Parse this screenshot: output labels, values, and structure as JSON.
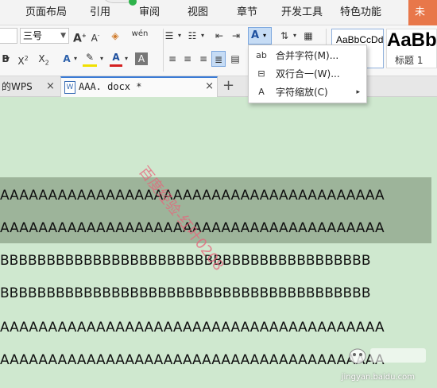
{
  "menu": {
    "items": [
      "页面布局",
      "引用",
      "审阅",
      "视图",
      "章节",
      "开发工具",
      "特色功能"
    ],
    "right_tab": "未"
  },
  "ribbon": {
    "font_size": "三号",
    "font_size_value": "三号",
    "styles": [
      {
        "preview": "AaBbCcDd",
        "name": ""
      },
      {
        "preview": "AaBb",
        "name": "标题 1"
      }
    ],
    "accent_color": "#3a7bd5",
    "font_color_underline": "#d42020",
    "highlight_underline": "#f0e000"
  },
  "tabs": {
    "first": "的WPS",
    "active": "AAA. docx *",
    "close_glyph": "×",
    "add_glyph": "+"
  },
  "dropdown": {
    "items": [
      {
        "label": "合并字符(M)...",
        "icon": "combine-chars-icon"
      },
      {
        "label": "双行合一(W)...",
        "icon": "two-lines-icon"
      },
      {
        "label": "字符缩放(C)",
        "icon": "char-scale-icon",
        "has_submenu": true
      }
    ]
  },
  "document": {
    "lines": [
      "AAAAAAAAAAAAAAAAAAAAAAAAAAAAAAAAAAAAAAAA",
      "AAAAAAAAAAAAAAAAAAAAAAAAAAAAAAAAAAAAAAAA",
      "BBBBBBBBBBBBBBBBBBBBBBBBBBBBBBBBBBBBBBBB",
      "BBBBBBBBBBBBBBBBBBBBBBBBBBBBBBBBBBBBBBBB",
      "AAAAAAAAAAAAAAAAAAAAAAAAAAAAAAAAAAAAAAAA",
      "AAAAAAAAAAAAAAAAAAAAAAAAAAAAAAAAAAAAAAAA"
    ],
    "selected_lines": [
      0,
      1
    ],
    "background": "#cfe8cf",
    "selection_color": "#9db49a",
    "watermark": "百度经验-红叶0208"
  },
  "footer_logo": {
    "text": "jingyan.baidu.com"
  }
}
